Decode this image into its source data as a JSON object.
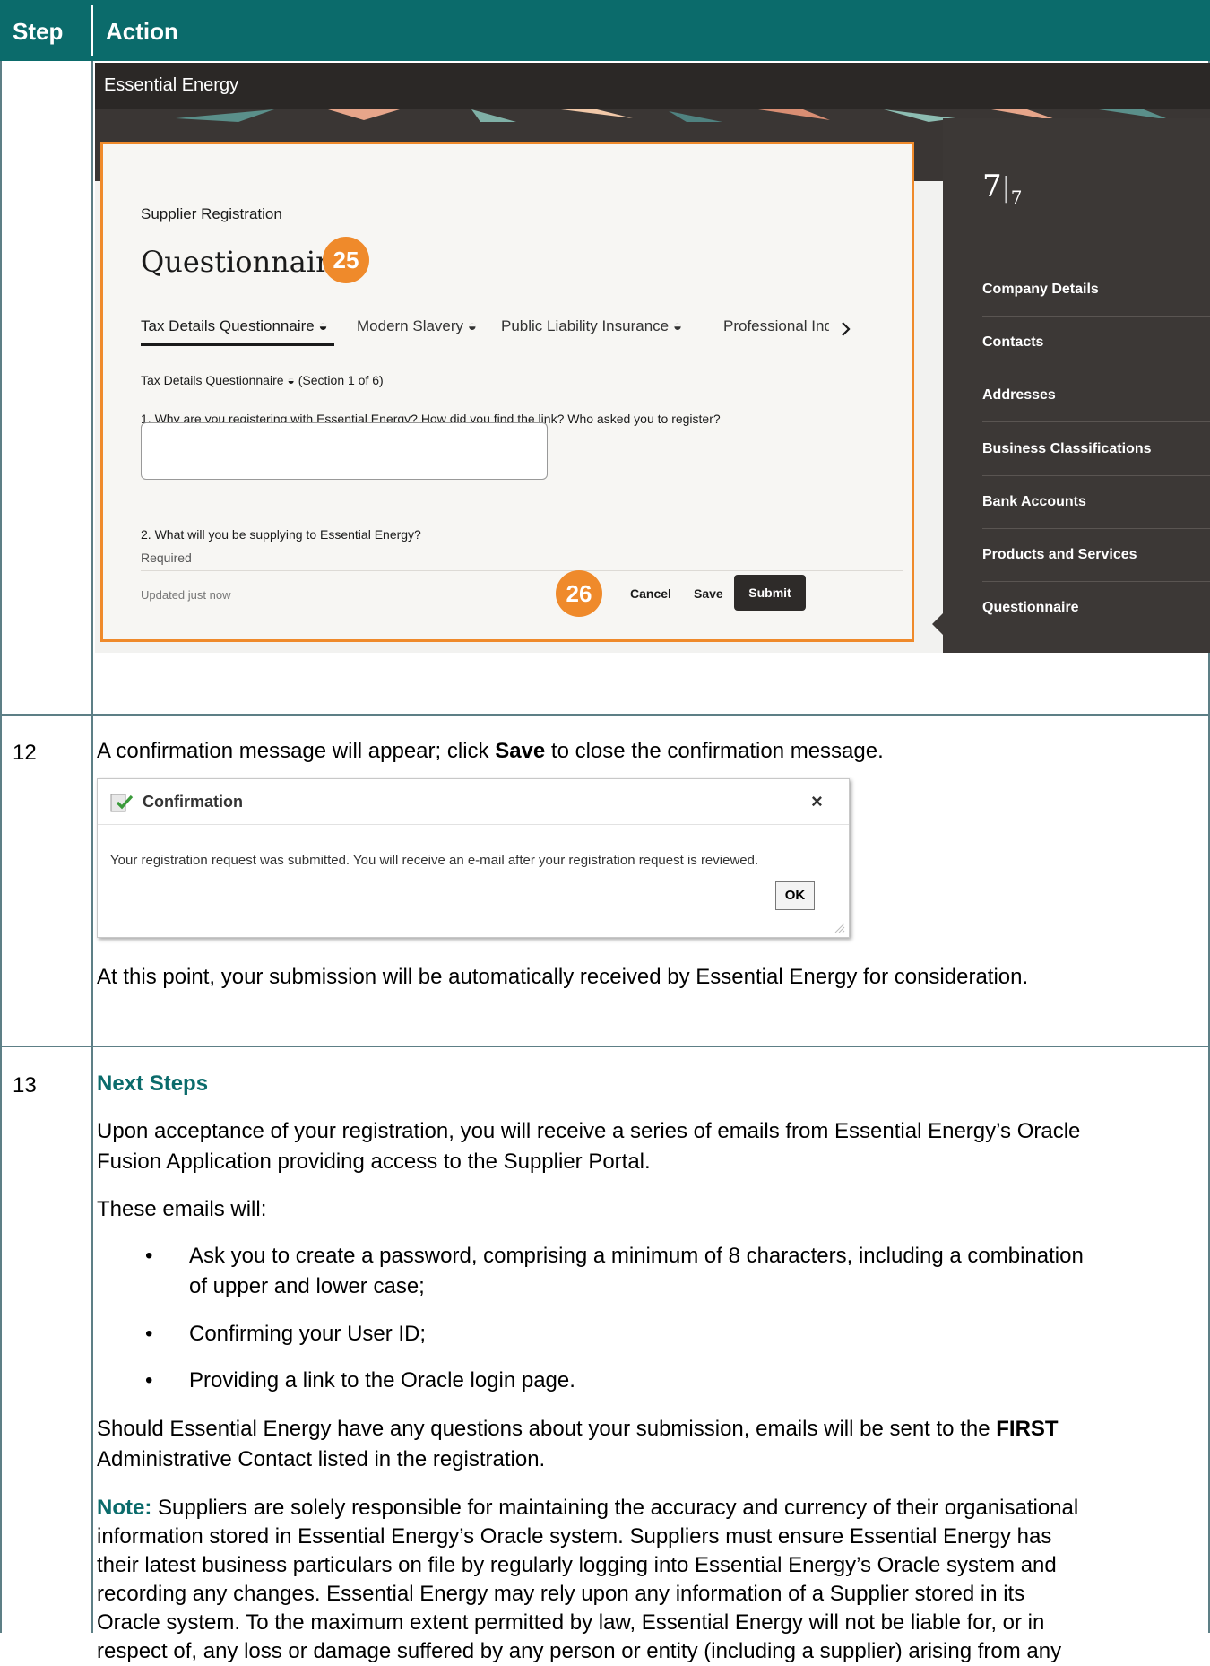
{
  "table_header": {
    "step": "Step",
    "action": "Action"
  },
  "screenshot1": {
    "app_title": "Essential Energy",
    "card": {
      "supplier_registration": "Supplier Registration",
      "title": "Questionnaire",
      "badge_top": "25",
      "badge_bottom": "26",
      "tabs": [
        "Tax Details Questionnaire ◒",
        "Modern Slavery ◒",
        "Public Liability Insurance ◒",
        "Professional Indemnity"
      ],
      "section_label": "Tax Details Questionnaire ◒ (Section 1 of 6)",
      "q1": "1. Why are you registering with Essential Energy? How did you find the link? Who asked you to register?",
      "required": "Required",
      "q2": "2. What will you be supplying to Essential Energy?",
      "updated": "Updated just now",
      "cancel": "Cancel",
      "save": "Save",
      "submit": "Submit"
    },
    "sidebar": {
      "progress_main": "7",
      "progress_sub": "7",
      "items": [
        "Company Details",
        "Contacts",
        "Addresses",
        "Business Classifications",
        "Bank Accounts",
        "Products and Services",
        "Questionnaire"
      ]
    }
  },
  "step12": {
    "number": "12",
    "text_pre": "A confirmation message will appear; click ",
    "text_bold": "Save",
    "text_post": " to close the confirmation message.",
    "dialog": {
      "title": "Confirmation",
      "close": "×",
      "message": "Your registration request was submitted. You will receive an e-mail after your registration request is reviewed.",
      "ok": "OK"
    },
    "after": "At this point, your submission will be automatically received by Essential Energy for consideration."
  },
  "step13": {
    "number": "13",
    "heading": "Next Steps",
    "p1_line1": "Upon acceptance of your registration, you will receive a series of emails from Essential Energy’s Oracle",
    "p1_line2": "Fusion Application providing access to the Supplier Portal.",
    "p2": "These emails will:",
    "b1_line1": "Ask you to create a password, comprising a minimum of 8 characters, including a combination",
    "b1_line2": "of upper and lower case;",
    "b2": "Confirming your User ID;",
    "b3": "Providing a link to the Oracle login page.",
    "p3_line1_pre": "Should Essential Energy have any questions about your submission, emails will be sent to the ",
    "p3_line1_bold": "FIRST",
    "p3_line2": "Administrative Contact listed in the registration.",
    "note_label": "Note:",
    "note_line1": " Suppliers are solely responsible for maintaining the accuracy and currency of their organisational",
    "note_line2": "information stored in Essential Energy’s Oracle system. Suppliers must ensure Essential Energy has",
    "note_line3": "their latest business particulars on file by regularly logging into Essential Energy’s Oracle system and",
    "note_line4": "recording any changes. Essential Energy may rely upon any information of a Supplier stored in its",
    "note_line5": "Oracle system. To the maximum extent permitted by law, Essential Energy will not be liable for, or in",
    "note_line6": "respect of, any loss or damage suffered by any person or entity (including a supplier) arising from any"
  }
}
